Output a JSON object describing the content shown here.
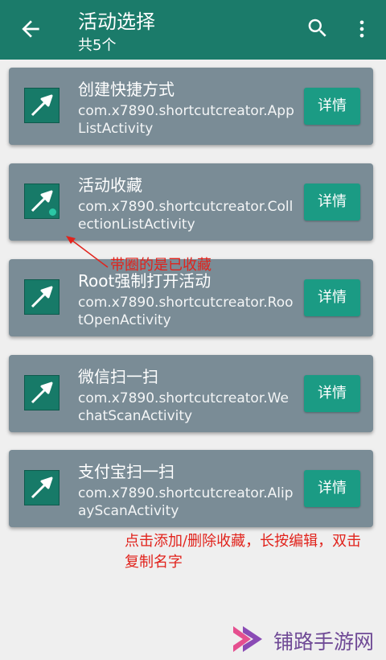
{
  "header": {
    "title": "活动选择",
    "subtitle": "共5个",
    "back_icon": "arrow-left-icon",
    "search_icon": "search-icon",
    "more_icon": "more-vert-icon",
    "color": "#1b7b6a"
  },
  "activities": [
    {
      "name": "创建快捷方式",
      "package": "com.x7890.shortcutcreator.AppListActivity",
      "detail_label": "详情",
      "favorited": false
    },
    {
      "name": "活动收藏",
      "package": "com.x7890.shortcutcreator.CollectionListActivity",
      "detail_label": "详情",
      "favorited": true
    },
    {
      "name": "Root强制打开活动",
      "package": "com.x7890.shortcutcreator.RootOpenActivity",
      "detail_label": "详情",
      "favorited": false
    },
    {
      "name": "微信扫一扫",
      "package": "com.x7890.shortcutcreator.WechatScanActivity",
      "detail_label": "详情",
      "favorited": false
    },
    {
      "name": "支付宝扫一扫",
      "package": "com.x7890.shortcutcreator.AlipayScanActivity",
      "detail_label": "详情",
      "favorited": false
    }
  ],
  "annotations": {
    "favorite_note": "带圈的是已收藏",
    "usage_note": "点击添加/删除收藏，长按编辑，双击复制名字",
    "color": "#e1231c"
  },
  "watermark": {
    "text": "铺路手游网"
  },
  "colors": {
    "card": "#7a8c96",
    "detail_button": "#1b9b84",
    "icon_bg": "#177a68",
    "fav_dot": "#2cc7a6"
  }
}
